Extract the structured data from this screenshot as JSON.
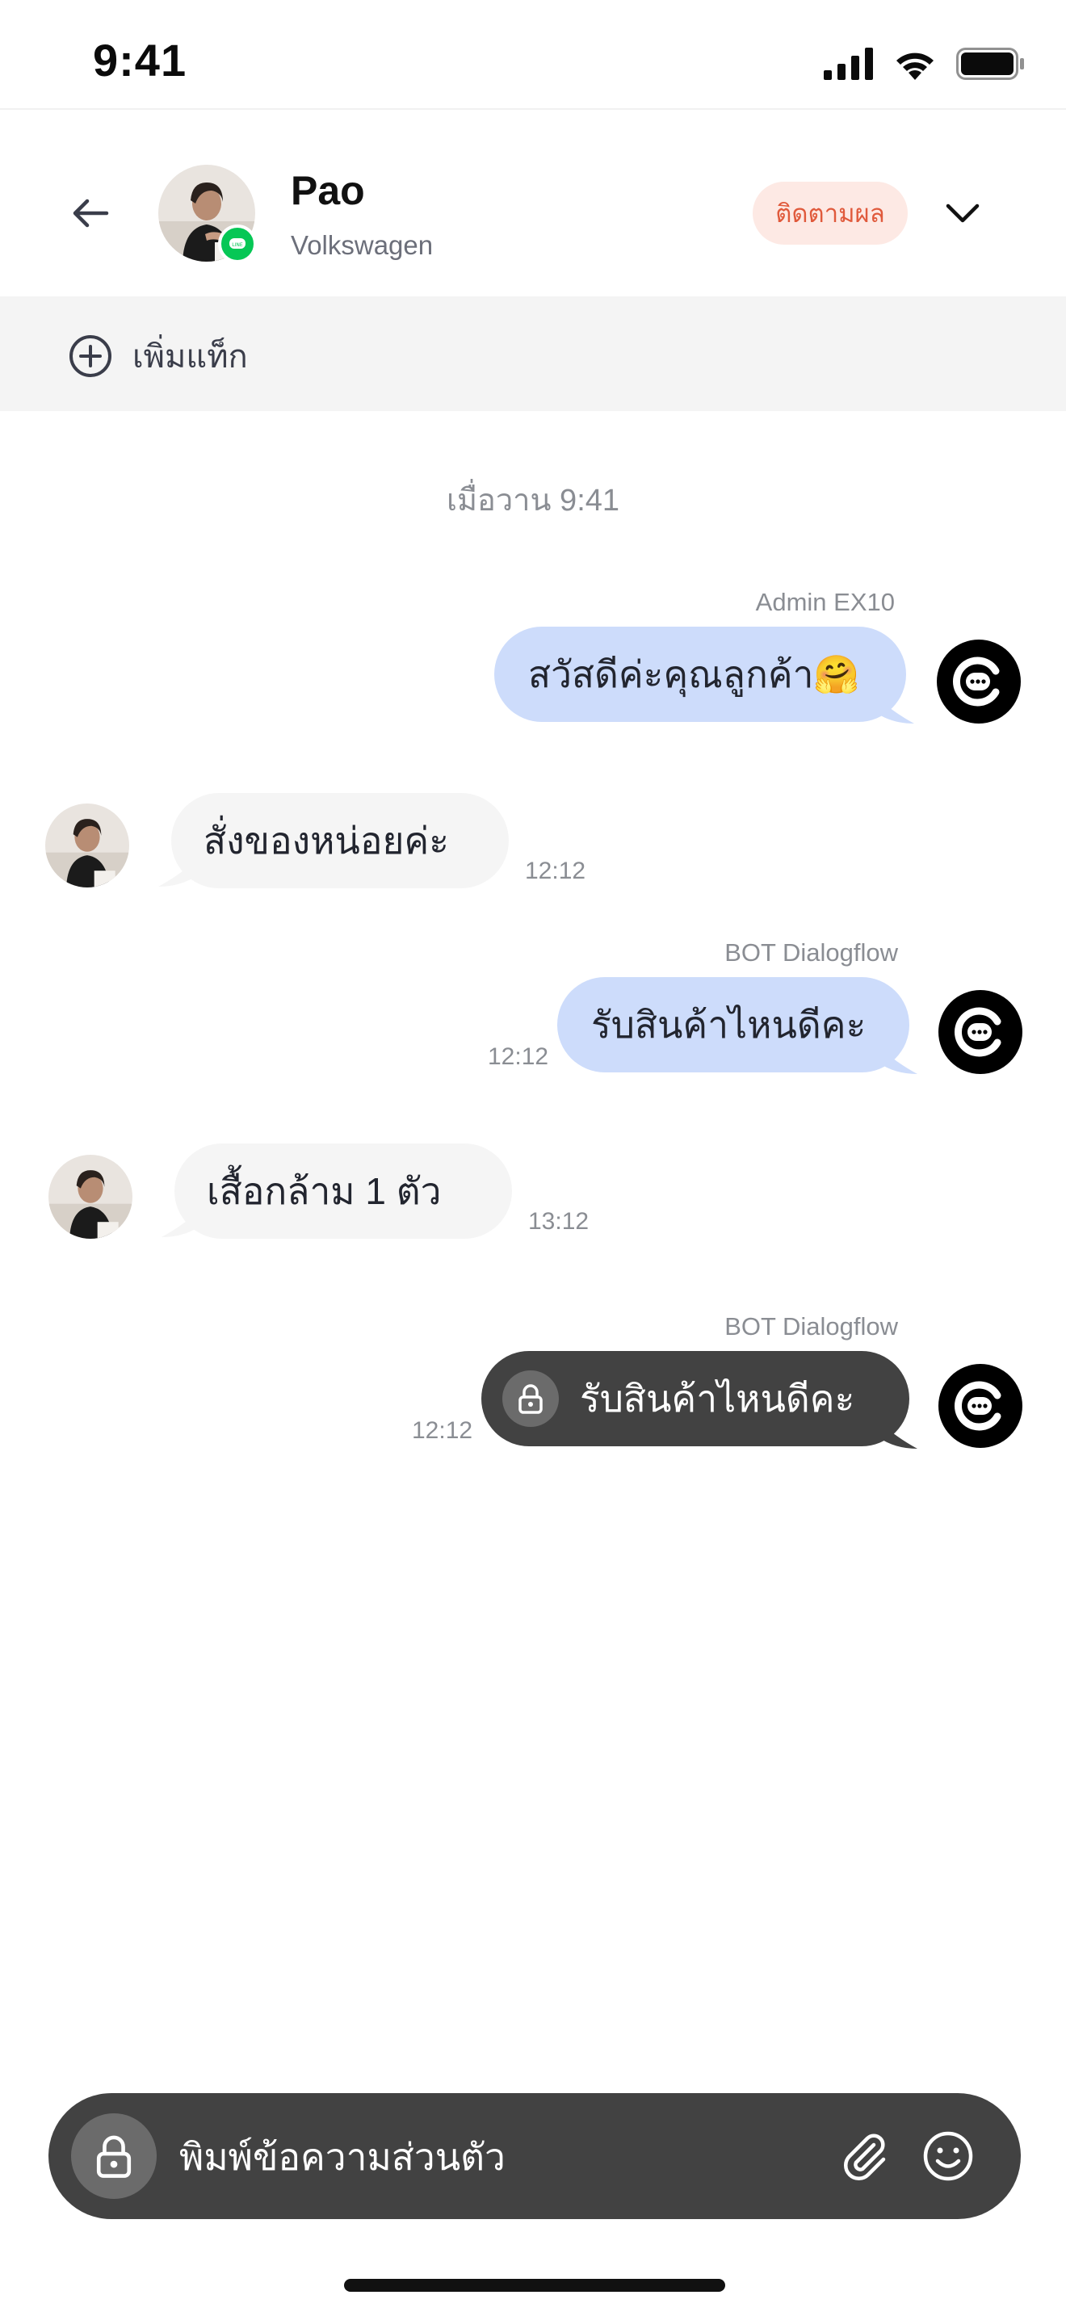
{
  "status_bar": {
    "time": "9:41"
  },
  "header": {
    "contact_name": "Pao",
    "contact_company": "Volkswagen",
    "follow_label": "ติดตามผล",
    "channel_icon": "line-icon"
  },
  "tag_bar": {
    "add_tag_label": "เพิ่มแท็ก"
  },
  "chat": {
    "date_separator": "เมื่อวาน 9:41",
    "messages": [
      {
        "direction": "outgoing",
        "sender": "Admin EX10",
        "text": "สวัสดีค่ะคุณลูกค้า🤗",
        "time": ""
      },
      {
        "direction": "incoming",
        "sender": "",
        "text": "สั่งของหน่อยค่ะ",
        "time": "12:12"
      },
      {
        "direction": "outgoing",
        "sender": "BOT Dialogflow",
        "text": "รับสินค้าไหนดีคะ",
        "time": "12:12"
      },
      {
        "direction": "incoming",
        "sender": "",
        "text": "เสื้อกล้าม 1 ตัว",
        "time": "13:12"
      },
      {
        "direction": "outgoing-private",
        "sender": "BOT Dialogflow",
        "text": "รับสินค้าไหนดีคะ",
        "time": "12:12"
      }
    ]
  },
  "composer": {
    "placeholder": "พิมพ์ข้อความส่วนตัว"
  },
  "colors": {
    "outgoing_bubble": "#cddcfb",
    "incoming_bubble": "#f5f5f5",
    "private_bubble": "#424242",
    "follow_badge_bg": "#fde9e4",
    "follow_badge_text": "#e05a3c",
    "line_green": "#06c755"
  }
}
